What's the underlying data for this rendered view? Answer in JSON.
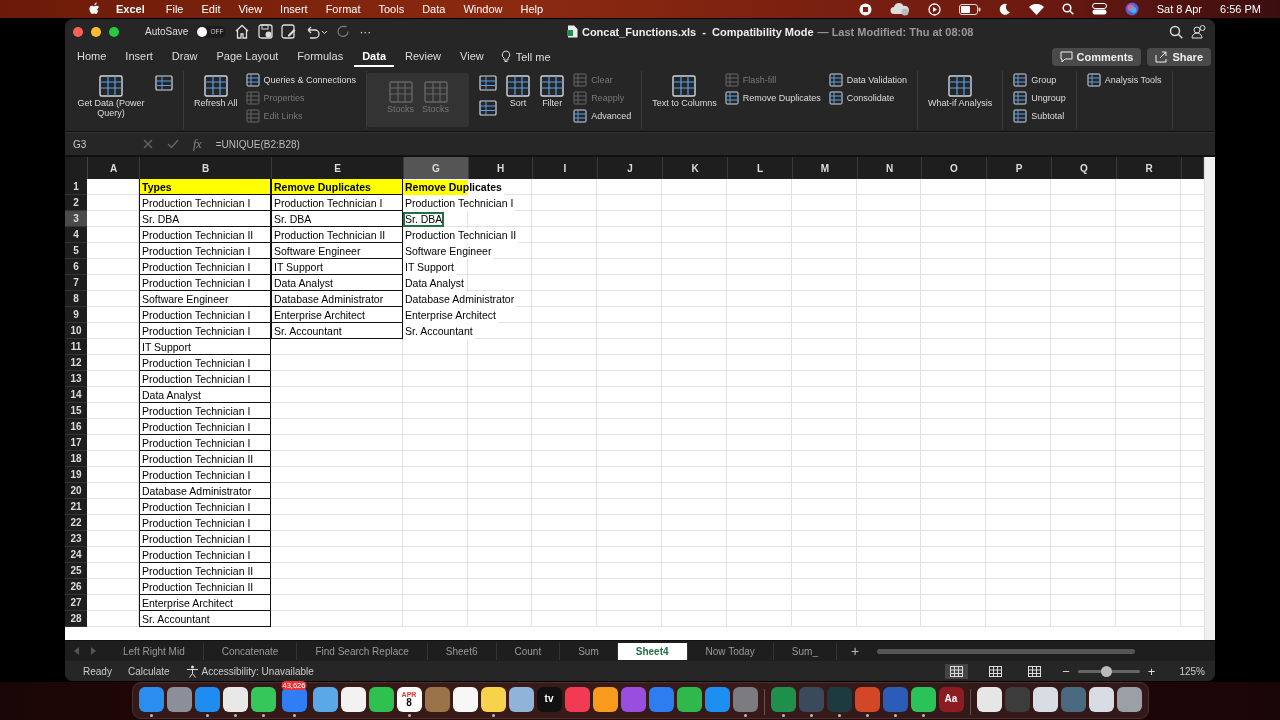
{
  "menu_bar": {
    "app": "Excel",
    "items": [
      "File",
      "Edit",
      "View",
      "Insert",
      "Format",
      "Tools",
      "Data",
      "Window",
      "Help"
    ],
    "date": "Sat 8 Apr",
    "time": "6:56 PM"
  },
  "title_bar": {
    "autosave_label": "AutoSave",
    "autosave": {
      "on": false,
      "label": "OFF"
    },
    "more": "···",
    "file": "Concat_Functions.xls  -  Compatibility Mode",
    "modified": "— Last Modified: Thu at 08:08"
  },
  "tabs": [
    {
      "label": "Home",
      "selected": false
    },
    {
      "label": "Insert",
      "selected": false
    },
    {
      "label": "Draw",
      "selected": false
    },
    {
      "label": "Page Layout",
      "selected": false
    },
    {
      "label": "Formulas",
      "selected": false
    },
    {
      "label": "Data",
      "selected": true
    },
    {
      "label": "Review",
      "selected": false
    },
    {
      "label": "View",
      "selected": false
    }
  ],
  "tell_me": "Tell me",
  "comments_button": "Comments",
  "share_button": "Share",
  "ribbon": [
    {
      "kind": "plain",
      "columns": [
        [
          {
            "kind": "big",
            "label": "Get Data (Power Query)",
            "disabled": false
          }
        ],
        [
          {
            "kind": "icon",
            "disabled": false
          }
        ]
      ]
    },
    {
      "kind": "plain",
      "columns": [
        [
          {
            "kind": "big",
            "label": "Refresh All",
            "disabled": false
          }
        ],
        [
          {
            "kind": "small",
            "label": "Queries & Connections",
            "disabled": false
          },
          {
            "kind": "small",
            "label": "Properties",
            "disabled": true
          },
          {
            "kind": "small",
            "label": "Edit Links",
            "disabled": true
          }
        ]
      ]
    },
    {
      "kind": "panel",
      "columns": [
        [
          {
            "kind": "big",
            "label": "Stocks",
            "disabled": true
          }
        ],
        [
          {
            "kind": "big",
            "label": "Stocks",
            "disabled": true
          }
        ]
      ]
    },
    {
      "kind": "plain",
      "columns": [
        [
          {
            "kind": "icon",
            "disabled": false
          },
          {
            "kind": "icon",
            "disabled": false
          }
        ],
        [
          {
            "kind": "big",
            "label": "Sort",
            "disabled": false
          }
        ],
        [
          {
            "kind": "big",
            "label": "Filter",
            "disabled": false
          }
        ],
        [
          {
            "kind": "small",
            "label": "Clear",
            "disabled": true
          },
          {
            "kind": "small",
            "label": "Reapply",
            "disabled": true
          },
          {
            "kind": "small",
            "label": "Advanced",
            "disabled": false
          }
        ]
      ]
    },
    {
      "kind": "plain",
      "columns": [
        [
          {
            "kind": "big",
            "label": "Text to Columns",
            "disabled": false
          }
        ],
        [
          {
            "kind": "small",
            "label": "Flash-fill",
            "disabled": true
          },
          {
            "kind": "small",
            "label": "Remove Duplicates",
            "disabled": false
          }
        ],
        [
          {
            "kind": "small",
            "label": "Data Validation",
            "disabled": false
          },
          {
            "kind": "small",
            "label": "Consolidate",
            "disabled": false
          }
        ]
      ]
    },
    {
      "kind": "plain",
      "columns": [
        [
          {
            "kind": "big",
            "label": "What-if Analysis",
            "disabled": false
          }
        ]
      ]
    },
    {
      "kind": "plain",
      "columns": [
        [
          {
            "kind": "small",
            "label": "Group",
            "disabled": false
          },
          {
            "kind": "small",
            "label": "Ungroup",
            "disabled": false
          },
          {
            "kind": "small",
            "label": "Subtotal",
            "disabled": false
          }
        ]
      ]
    },
    {
      "kind": "plain",
      "columns": [
        [
          {
            "kind": "small",
            "label": "Analysis Tools",
            "disabled": false
          }
        ]
      ]
    }
  ],
  "formula_bar": {
    "name_box": "G3",
    "fx": "fx",
    "formula": "=UNIQUE(B2:B28)"
  },
  "columns": [
    {
      "letter": "A",
      "selected": false
    },
    {
      "letter": "B",
      "selected": false
    },
    {
      "letter": "E",
      "selected": false
    },
    {
      "letter": "G",
      "selected": true
    },
    {
      "letter": "H",
      "selected": false
    },
    {
      "letter": "I",
      "selected": false
    },
    {
      "letter": "J",
      "selected": false
    },
    {
      "letter": "K",
      "selected": false
    },
    {
      "letter": "L",
      "selected": false
    },
    {
      "letter": "M",
      "selected": false
    },
    {
      "letter": "N",
      "selected": false
    },
    {
      "letter": "O",
      "selected": false
    },
    {
      "letter": "P",
      "selected": false
    },
    {
      "letter": "Q",
      "selected": false
    },
    {
      "letter": "R",
      "selected": false
    }
  ],
  "rows": [
    {
      "num": "1",
      "header": true,
      "selected": false,
      "b": "Types",
      "e": "Remove Duplicates",
      "g": "Remove Duplicates"
    },
    {
      "num": "2",
      "header": false,
      "selected": false,
      "b": "Production Technician I",
      "e": "Production Technician I",
      "g": "Production Technician I"
    },
    {
      "num": "3",
      "header": false,
      "selected": true,
      "b": "Sr. DBA",
      "e": "Sr. DBA",
      "g": "Sr. DBA"
    },
    {
      "num": "4",
      "header": false,
      "selected": false,
      "b": "Production Technician II",
      "e": "Production Technician II",
      "g": "Production Technician II"
    },
    {
      "num": "5",
      "header": false,
      "selected": false,
      "b": "Production Technician I",
      "e": "Software Engineer",
      "g": "Software Engineer"
    },
    {
      "num": "6",
      "header": false,
      "selected": false,
      "b": "Production Technician I",
      "e": "IT Support",
      "g": "IT Support"
    },
    {
      "num": "7",
      "header": false,
      "selected": false,
      "b": "Production Technician I",
      "e": "Data Analyst",
      "g": "Data Analyst"
    },
    {
      "num": "8",
      "header": false,
      "selected": false,
      "b": "Software Engineer",
      "e": "Database Administrator",
      "g": "Database Administrator"
    },
    {
      "num": "9",
      "header": false,
      "selected": false,
      "b": "Production Technician I",
      "e": "Enterprise Architect",
      "g": "Enterprise Architect"
    },
    {
      "num": "10",
      "header": false,
      "selected": false,
      "b": "Production Technician I",
      "e": "Sr. Accountant",
      "g": "Sr. Accountant"
    },
    {
      "num": "11",
      "header": false,
      "selected": false,
      "b": "IT Support"
    },
    {
      "num": "12",
      "header": false,
      "selected": false,
      "b": "Production Technician I"
    },
    {
      "num": "13",
      "header": false,
      "selected": false,
      "b": "Production Technician I"
    },
    {
      "num": "14",
      "header": false,
      "selected": false,
      "b": "Data Analyst"
    },
    {
      "num": "15",
      "header": false,
      "selected": false,
      "b": "Production Technician I"
    },
    {
      "num": "16",
      "header": false,
      "selected": false,
      "b": "Production Technician I"
    },
    {
      "num": "17",
      "header": false,
      "selected": false,
      "b": "Production Technician I"
    },
    {
      "num": "18",
      "header": false,
      "selected": false,
      "b": "Production Technician II"
    },
    {
      "num": "19",
      "header": false,
      "selected": false,
      "b": "Production Technician I"
    },
    {
      "num": "20",
      "header": false,
      "selected": false,
      "b": "Database Administrator"
    },
    {
      "num": "21",
      "header": false,
      "selected": false,
      "b": "Production Technician I"
    },
    {
      "num": "22",
      "header": false,
      "selected": false,
      "b": "Production Technician I"
    },
    {
      "num": "23",
      "header": false,
      "selected": false,
      "b": "Production Technician I"
    },
    {
      "num": "24",
      "header": false,
      "selected": false,
      "b": "Production Technician I"
    },
    {
      "num": "25",
      "header": false,
      "selected": false,
      "b": "Production Technician II"
    },
    {
      "num": "26",
      "header": false,
      "selected": false,
      "b": "Production Technician II"
    },
    {
      "num": "27",
      "header": false,
      "selected": false,
      "b": "Enterprise Architect"
    },
    {
      "num": "28",
      "header": false,
      "selected": false,
      "b": "Sr. Accountant"
    }
  ],
  "sheet_tabs": [
    {
      "label": "Left Right Mid",
      "selected": false
    },
    {
      "label": "Concatenate",
      "selected": false
    },
    {
      "label": "Find Search Replace",
      "selected": false
    },
    {
      "label": "Sheet6",
      "selected": false
    },
    {
      "label": "Count",
      "selected": false
    },
    {
      "label": "Sum",
      "selected": false
    },
    {
      "label": "Sheet4",
      "selected": true
    },
    {
      "label": "Now Today",
      "selected": false
    },
    {
      "label": "Sum_",
      "selected": false
    }
  ],
  "add_sheet": "+",
  "status_bar": {
    "items": [
      "Ready",
      "Calculate"
    ],
    "accessibility": "Accessibility: Unavailable",
    "views": [
      {
        "selected": true
      },
      {
        "selected": false
      },
      {
        "selected": false
      }
    ],
    "zoom_out": "−",
    "zoom_in": "+",
    "zoom": {
      "level": 0.46
    },
    "zoom_label": "125%"
  },
  "dock": [
    {
      "kind": "app",
      "color": "#2a8ef0",
      "running": true
    },
    {
      "kind": "app",
      "color": "#8a8f99",
      "running": false
    },
    {
      "kind": "app",
      "color": "#1f8cf2",
      "running": true
    },
    {
      "kind": "app",
      "color": "#e8e8e8",
      "running": true
    },
    {
      "kind": "app",
      "color": "#35c759",
      "running": true
    },
    {
      "kind": "app",
      "color": "#2f7ef5",
      "running": true,
      "badge": "43,626"
    },
    {
      "kind": "app",
      "color": "#5aa8e8",
      "running": false
    },
    {
      "kind": "app",
      "color": "#f2f2f2",
      "running": false
    },
    {
      "kind": "app",
      "color": "#2ec14f",
      "running": false
    },
    {
      "kind": "app",
      "color": "#ffffff",
      "running": true,
      "top": "APR",
      "label": "8"
    },
    {
      "kind": "app",
      "color": "#9a7448",
      "running": false
    },
    {
      "kind": "app",
      "color": "#f7f7f7",
      "running": false
    },
    {
      "kind": "app",
      "color": "#f6d34a",
      "running": true
    },
    {
      "kind": "app",
      "color": "#8fb3d9",
      "running": false
    },
    {
      "kind": "app",
      "color": "#111111",
      "running": false,
      "label": "tv"
    },
    {
      "kind": "app",
      "color": "#f23b52",
      "running": false
    },
    {
      "kind": "app",
      "color": "#f79a1e",
      "running": false
    },
    {
      "kind": "app",
      "color": "#9a4ee0",
      "running": false
    },
    {
      "kind": "app",
      "color": "#2d7cf0",
      "running": false
    },
    {
      "kind": "app",
      "color": "#2fb94c",
      "running": false
    },
    {
      "kind": "app",
      "color": "#1c8ff0",
      "running": false
    },
    {
      "kind": "app",
      "color": "#7b7b80",
      "running": true
    },
    {
      "kind": "separator"
    },
    {
      "kind": "app",
      "color": "#1f8f4c",
      "running": true
    },
    {
      "kind": "app",
      "color": "#3a4a5c",
      "running": true
    },
    {
      "kind": "app",
      "color": "#1d3b3f",
      "running": true
    },
    {
      "kind": "app",
      "color": "#d24726",
      "running": true
    },
    {
      "kind": "app",
      "color": "#2b5cb8",
      "running": true
    },
    {
      "kind": "app",
      "color": "#29c35a",
      "running": true
    },
    {
      "kind": "app",
      "color": "#8c1c22",
      "running": false,
      "label": "Aa"
    },
    {
      "kind": "separator"
    },
    {
      "kind": "app",
      "color": "#e6e6e6",
      "running": false
    },
    {
      "kind": "app",
      "color": "#3c3c3c",
      "running": false
    },
    {
      "kind": "app",
      "color": "#d8dde3",
      "running": false
    },
    {
      "kind": "app",
      "color": "#4a6a80",
      "running": false
    },
    {
      "kind": "app",
      "color": "#d8dde3",
      "running": false
    },
    {
      "kind": "app",
      "color": "#9aa0a6",
      "running": false
    }
  ]
}
